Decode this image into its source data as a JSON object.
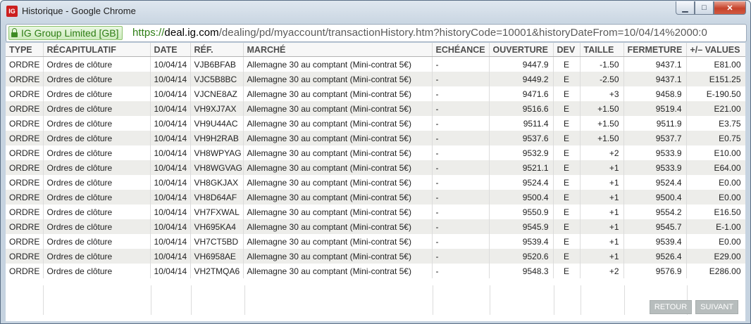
{
  "window": {
    "app_icon_label": "IG",
    "title": "Historique - Google Chrome",
    "controls": {
      "minimize": "▁",
      "maximize": "□",
      "close": "✕"
    }
  },
  "address_bar": {
    "site_name": "IG Group Limited [GB]",
    "scheme": "https://",
    "host": "deal.ig.com",
    "path": "/dealing/pd/myaccount/transactionHistory.htm?historyCode=10001&historyDateFrom=10/04/14%2000:0"
  },
  "table": {
    "headers": [
      "TYPE",
      "RÉCAPITULATIF",
      "DATE",
      "RÉF.",
      "MARCHÉ",
      "ECHÉANCE",
      "OUVERTURE",
      "DEV",
      "TAILLE",
      "FERMETURE",
      "+/– VALUES"
    ],
    "rows": [
      [
        "ORDRE",
        "Ordres de clôture",
        "10/04/14",
        "VJB6BFAB",
        "Allemagne 30 au comptant (Mini-contrat 5€)",
        "-",
        "9447.9",
        "E",
        "-1.50",
        "9437.1",
        "E81.00"
      ],
      [
        "ORDRE",
        "Ordres de clôture",
        "10/04/14",
        "VJC5B8BC",
        "Allemagne 30 au comptant (Mini-contrat 5€)",
        "-",
        "9449.2",
        "E",
        "-2.50",
        "9437.1",
        "E151.25"
      ],
      [
        "ORDRE",
        "Ordres de clôture",
        "10/04/14",
        "VJCNE8AZ",
        "Allemagne 30 au comptant (Mini-contrat 5€)",
        "-",
        "9471.6",
        "E",
        "+3",
        "9458.9",
        "E-190.50"
      ],
      [
        "ORDRE",
        "Ordres de clôture",
        "10/04/14",
        "VH9XJ7AX",
        "Allemagne 30 au comptant (Mini-contrat 5€)",
        "-",
        "9516.6",
        "E",
        "+1.50",
        "9519.4",
        "E21.00"
      ],
      [
        "ORDRE",
        "Ordres de clôture",
        "10/04/14",
        "VH9U44AC",
        "Allemagne 30 au comptant (Mini-contrat 5€)",
        "-",
        "9511.4",
        "E",
        "+1.50",
        "9511.9",
        "E3.75"
      ],
      [
        "ORDRE",
        "Ordres de clôture",
        "10/04/14",
        "VH9H2RAB",
        "Allemagne 30 au comptant (Mini-contrat 5€)",
        "-",
        "9537.6",
        "E",
        "+1.50",
        "9537.7",
        "E0.75"
      ],
      [
        "ORDRE",
        "Ordres de clôture",
        "10/04/14",
        "VH8WPYAG",
        "Allemagne 30 au comptant (Mini-contrat 5€)",
        "-",
        "9532.9",
        "E",
        "+2",
        "9533.9",
        "E10.00"
      ],
      [
        "ORDRE",
        "Ordres de clôture",
        "10/04/14",
        "VH8WGVAG",
        "Allemagne 30 au comptant (Mini-contrat 5€)",
        "-",
        "9521.1",
        "E",
        "+1",
        "9533.9",
        "E64.00"
      ],
      [
        "ORDRE",
        "Ordres de clôture",
        "10/04/14",
        "VH8GKJAX",
        "Allemagne 30 au comptant (Mini-contrat 5€)",
        "-",
        "9524.4",
        "E",
        "+1",
        "9524.4",
        "E0.00"
      ],
      [
        "ORDRE",
        "Ordres de clôture",
        "10/04/14",
        "VH8D64AF",
        "Allemagne 30 au comptant (Mini-contrat 5€)",
        "-",
        "9500.4",
        "E",
        "+1",
        "9500.4",
        "E0.00"
      ],
      [
        "ORDRE",
        "Ordres de clôture",
        "10/04/14",
        "VH7FXWAL",
        "Allemagne 30 au comptant (Mini-contrat 5€)",
        "-",
        "9550.9",
        "E",
        "+1",
        "9554.2",
        "E16.50"
      ],
      [
        "ORDRE",
        "Ordres de clôture",
        "10/04/14",
        "VH695KA4",
        "Allemagne 30 au comptant (Mini-contrat 5€)",
        "-",
        "9545.9",
        "E",
        "+1",
        "9545.7",
        "E-1.00"
      ],
      [
        "ORDRE",
        "Ordres de clôture",
        "10/04/14",
        "VH7CT5BD",
        "Allemagne 30 au comptant (Mini-contrat 5€)",
        "-",
        "9539.4",
        "E",
        "+1",
        "9539.4",
        "E0.00"
      ],
      [
        "ORDRE",
        "Ordres de clôture",
        "10/04/14",
        "VH6958AE",
        "Allemagne 30 au comptant (Mini-contrat 5€)",
        "-",
        "9520.6",
        "E",
        "+1",
        "9526.4",
        "E29.00"
      ],
      [
        "ORDRE",
        "Ordres de clôture",
        "10/04/14",
        "VH2TMQA6",
        "Allemagne 30 au comptant (Mini-contrat 5€)",
        "-",
        "9548.3",
        "E",
        "+2",
        "9576.9",
        "E286.00"
      ]
    ]
  },
  "footer": {
    "back_label": "RETOUR",
    "next_label": "SUIVANT"
  }
}
